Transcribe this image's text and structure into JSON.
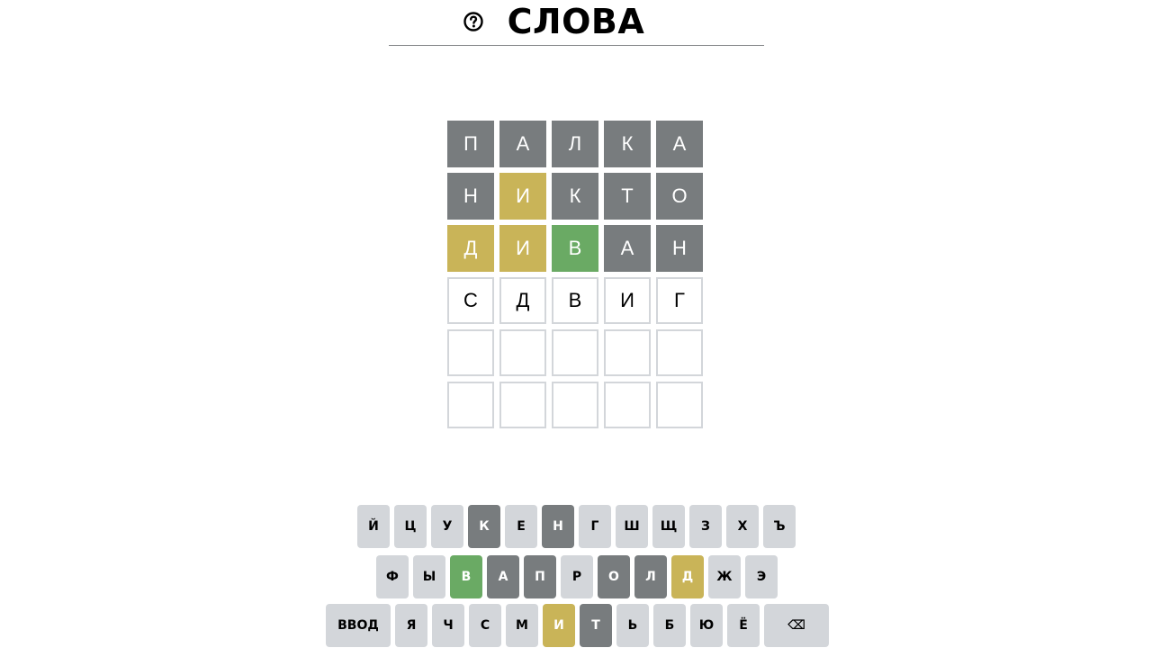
{
  "header": {
    "title": "СЛОВА",
    "help_icon": "question-circle-icon"
  },
  "board": {
    "rows": [
      [
        {
          "letter": "П",
          "state": "gray"
        },
        {
          "letter": "А",
          "state": "gray"
        },
        {
          "letter": "Л",
          "state": "gray"
        },
        {
          "letter": "К",
          "state": "gray"
        },
        {
          "letter": "А",
          "state": "gray"
        }
      ],
      [
        {
          "letter": "Н",
          "state": "gray"
        },
        {
          "letter": "И",
          "state": "yellow"
        },
        {
          "letter": "К",
          "state": "gray"
        },
        {
          "letter": "Т",
          "state": "gray"
        },
        {
          "letter": "О",
          "state": "gray"
        }
      ],
      [
        {
          "letter": "Д",
          "state": "yellow"
        },
        {
          "letter": "И",
          "state": "yellow"
        },
        {
          "letter": "В",
          "state": "green"
        },
        {
          "letter": "А",
          "state": "gray"
        },
        {
          "letter": "Н",
          "state": "gray"
        }
      ],
      [
        {
          "letter": "С",
          "state": "filled"
        },
        {
          "letter": "Д",
          "state": "filled"
        },
        {
          "letter": "В",
          "state": "filled"
        },
        {
          "letter": "И",
          "state": "filled"
        },
        {
          "letter": "Г",
          "state": "filled"
        }
      ],
      [
        {
          "letter": "",
          "state": "empty"
        },
        {
          "letter": "",
          "state": "empty"
        },
        {
          "letter": "",
          "state": "empty"
        },
        {
          "letter": "",
          "state": "empty"
        },
        {
          "letter": "",
          "state": "empty"
        }
      ],
      [
        {
          "letter": "",
          "state": "empty"
        },
        {
          "letter": "",
          "state": "empty"
        },
        {
          "letter": "",
          "state": "empty"
        },
        {
          "letter": "",
          "state": "empty"
        },
        {
          "letter": "",
          "state": "empty"
        }
      ]
    ]
  },
  "keyboard": {
    "rows": [
      [
        {
          "label": "Й",
          "state": "unused"
        },
        {
          "label": "Ц",
          "state": "unused"
        },
        {
          "label": "У",
          "state": "unused"
        },
        {
          "label": "К",
          "state": "gray"
        },
        {
          "label": "Е",
          "state": "unused"
        },
        {
          "label": "Н",
          "state": "gray"
        },
        {
          "label": "Г",
          "state": "unused"
        },
        {
          "label": "Ш",
          "state": "unused"
        },
        {
          "label": "Щ",
          "state": "unused"
        },
        {
          "label": "З",
          "state": "unused"
        },
        {
          "label": "Х",
          "state": "unused"
        },
        {
          "label": "Ъ",
          "state": "unused"
        }
      ],
      [
        {
          "label": "Ф",
          "state": "unused"
        },
        {
          "label": "Ы",
          "state": "unused"
        },
        {
          "label": "В",
          "state": "green"
        },
        {
          "label": "А",
          "state": "gray"
        },
        {
          "label": "П",
          "state": "gray"
        },
        {
          "label": "Р",
          "state": "unused"
        },
        {
          "label": "О",
          "state": "gray"
        },
        {
          "label": "Л",
          "state": "gray"
        },
        {
          "label": "Д",
          "state": "yellow"
        },
        {
          "label": "Ж",
          "state": "unused"
        },
        {
          "label": "Э",
          "state": "unused"
        }
      ],
      [
        {
          "label": "ВВОД",
          "state": "unused",
          "wide": true,
          "name": "enter-key"
        },
        {
          "label": "Я",
          "state": "unused"
        },
        {
          "label": "Ч",
          "state": "unused"
        },
        {
          "label": "С",
          "state": "unused"
        },
        {
          "label": "М",
          "state": "unused"
        },
        {
          "label": "И",
          "state": "yellow"
        },
        {
          "label": "Т",
          "state": "gray"
        },
        {
          "label": "Ь",
          "state": "unused"
        },
        {
          "label": "Б",
          "state": "unused"
        },
        {
          "label": "Ю",
          "state": "unused"
        },
        {
          "label": "Ё",
          "state": "unused"
        },
        {
          "label": "⌫",
          "state": "unused",
          "wide": true,
          "name": "backspace-key"
        }
      ]
    ]
  },
  "colors": {
    "gray": "#787c7e",
    "yellow": "#c9b458",
    "green": "#6aaa64",
    "key_default": "#d3d6da",
    "tile_border": "#d3d6da"
  }
}
